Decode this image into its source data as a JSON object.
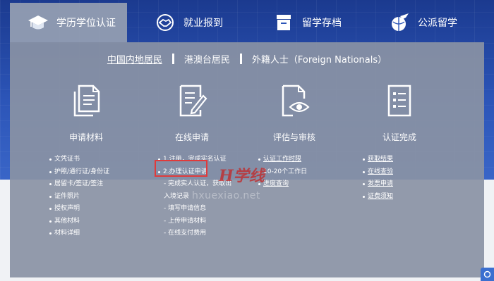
{
  "nav": {
    "tabs": [
      {
        "label": "学历学位认证",
        "icon": "graduation-cap-icon",
        "active": true
      },
      {
        "label": "就业报到",
        "icon": "handshake-icon",
        "active": false
      },
      {
        "label": "留学存档",
        "icon": "archive-box-icon",
        "active": false
      },
      {
        "label": "公派留学",
        "icon": "plane-globe-icon",
        "active": false
      }
    ]
  },
  "residency": {
    "options": [
      "中国内地居民",
      "港澳台居民",
      "外籍人士（Foreign Nationals）"
    ],
    "active_index": 0
  },
  "steps": [
    {
      "label": "申请材料",
      "icon": "documents-icon"
    },
    {
      "label": "在线申请",
      "icon": "form-edit-icon"
    },
    {
      "label": "评估与审核",
      "icon": "document-eye-icon"
    },
    {
      "label": "认证完成",
      "icon": "checklist-icon"
    }
  ],
  "columns": {
    "materials": [
      "文凭证书",
      "护照/通行证/身份证",
      "居留卡/签证/签注",
      "证件照片",
      "授权声明",
      "其他材料",
      "材料详细"
    ],
    "online": {
      "numbered": [
        "1.注册，完成实名认证",
        "2.办理认证申请"
      ],
      "sub": [
        "- 完成实人认证，获取出",
        "入境记录",
        "- 填写申请信息",
        "- 上传申请材料",
        "- 在线支付费用"
      ]
    },
    "review": [
      "认证工作时限",
      "10-20个工作日",
      "进度查询"
    ],
    "complete": [
      "获取结果",
      "在线查验",
      "发票申请",
      "证费须知"
    ]
  },
  "watermark": {
    "script": "H学线",
    "url": "hxuexiao.net"
  },
  "colors": {
    "panel": "#8a92a4",
    "hero": "#2c55b8",
    "highlight": "#e03b3b"
  }
}
